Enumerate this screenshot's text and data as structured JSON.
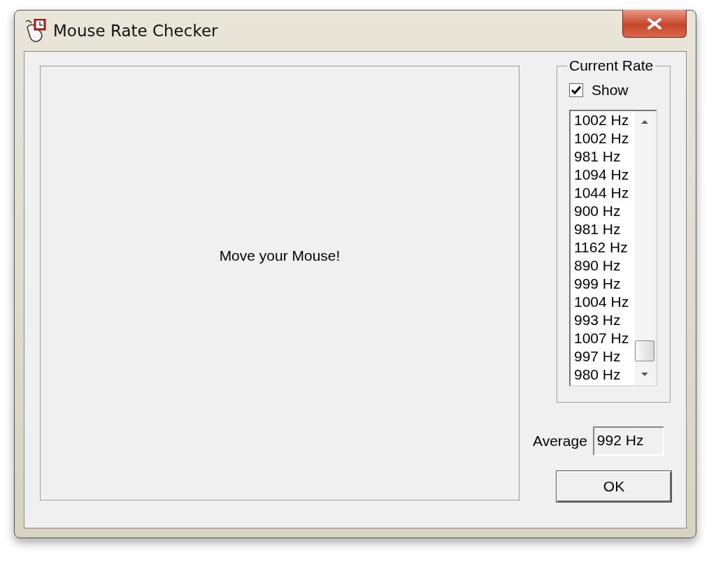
{
  "window": {
    "title": "Mouse Rate Checker"
  },
  "canvas": {
    "message": "Move your Mouse!"
  },
  "current_rate": {
    "title": "Current Rate",
    "show": {
      "label": "Show",
      "checked": true
    },
    "rates": [
      "1002 Hz",
      "1002 Hz",
      "981 Hz",
      "1094 Hz",
      "1044 Hz",
      "900 Hz",
      "981 Hz",
      "1162 Hz",
      "890 Hz",
      "999 Hz",
      "1004 Hz",
      "993 Hz",
      "1007 Hz",
      "997 Hz",
      "980 Hz"
    ]
  },
  "average": {
    "label": "Average",
    "value": "992 Hz"
  },
  "buttons": [
    "OK"
  ]
}
